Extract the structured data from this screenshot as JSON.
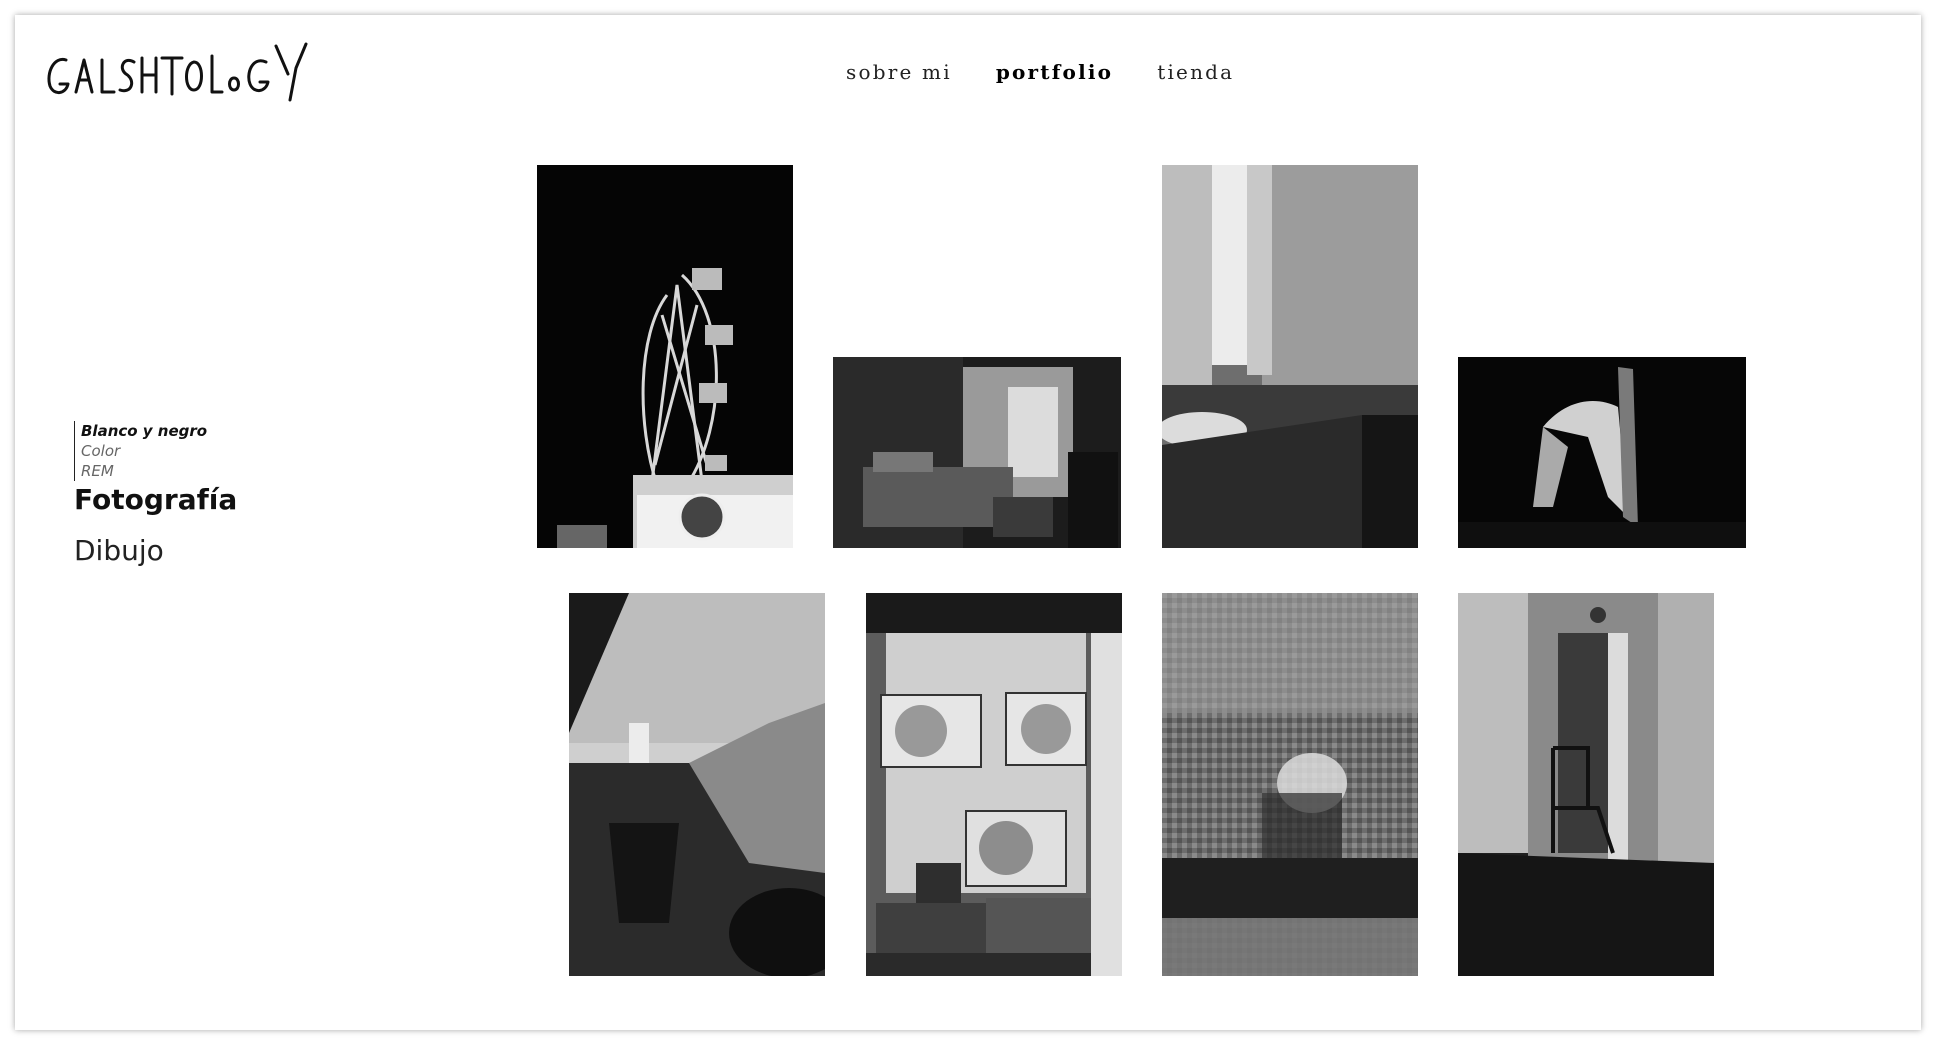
{
  "site": {
    "logo_text": "GALSHTOLOGY"
  },
  "nav": {
    "items": [
      {
        "label": "sobre mi",
        "active": false
      },
      {
        "label": "portfolio",
        "active": true
      },
      {
        "label": "tienda",
        "active": false
      }
    ]
  },
  "sidebar": {
    "subcategories": [
      {
        "label": "Blanco y negro",
        "active": true
      },
      {
        "label": "Color",
        "active": false
      },
      {
        "label": "REM",
        "active": false
      }
    ],
    "categories": [
      {
        "label": "Fotografía",
        "active": true
      },
      {
        "label": "Dibujo",
        "active": false
      }
    ]
  },
  "gallery": {
    "photos": [
      {
        "subject": "ferris-wheel-night"
      },
      {
        "subject": "bedroom-window"
      },
      {
        "subject": "kitchen-window"
      },
      {
        "subject": "hanging-cloth"
      },
      {
        "subject": "rooftop-sky"
      },
      {
        "subject": "air-conditioners"
      },
      {
        "subject": "frosted-glass-hand"
      },
      {
        "subject": "hallway-chair"
      }
    ]
  }
}
